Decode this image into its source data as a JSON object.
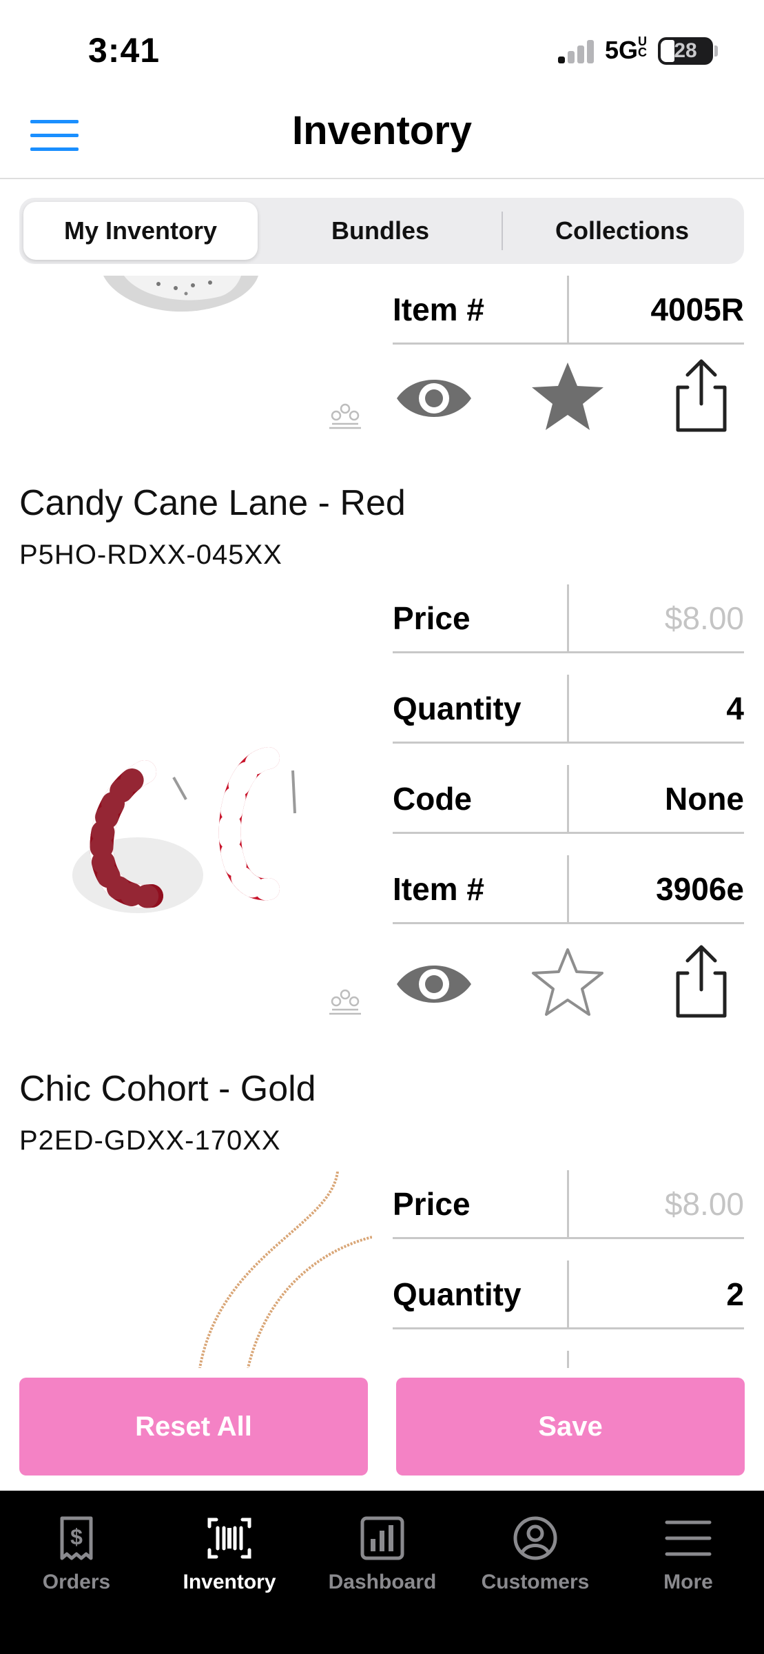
{
  "status_bar": {
    "time": "3:41",
    "network": "5G",
    "network_suffix": "UC",
    "battery": "28",
    "battery_level_fraction": 0.28
  },
  "header": {
    "title": "Inventory",
    "menu_icon": "hamburger-menu-icon",
    "accent_color": "#1a8fff"
  },
  "segments": [
    {
      "label": "My Inventory",
      "active": true
    },
    {
      "label": "Bundles",
      "active": false
    },
    {
      "label": "Collections",
      "active": false
    }
  ],
  "items": [
    {
      "name": "",
      "sku": "",
      "fields": [
        {
          "label": "Item #",
          "value": "4005R"
        }
      ],
      "favorited": true
    },
    {
      "name": "Candy Cane Lane - Red",
      "sku": "P5HO-RDXX-045XX",
      "fields": [
        {
          "label": "Price",
          "value": "$8.00",
          "muted": true
        },
        {
          "label": "Quantity",
          "value": "4"
        },
        {
          "label": "Code",
          "value": "None"
        },
        {
          "label": "Item #",
          "value": "3906e"
        }
      ],
      "favorited": false
    },
    {
      "name": "Chic Cohort - Gold",
      "sku": "P2ED-GDXX-170XX",
      "fields": [
        {
          "label": "Price",
          "value": "$8.00",
          "muted": true
        },
        {
          "label": "Quantity",
          "value": "2"
        }
      ],
      "favorited": false
    }
  ],
  "actions": {
    "reset_label": "Reset All",
    "save_label": "Save",
    "button_color": "#f482c5"
  },
  "tab_bar": {
    "tabs": [
      {
        "label": "Orders",
        "icon": "receipt-dollar-icon",
        "active": false
      },
      {
        "label": "Inventory",
        "icon": "barcode-scan-icon",
        "active": true
      },
      {
        "label": "Dashboard",
        "icon": "bar-chart-icon",
        "active": false
      },
      {
        "label": "Customers",
        "icon": "person-circle-icon",
        "active": false
      },
      {
        "label": "More",
        "icon": "more-lines-icon",
        "active": false
      }
    ]
  }
}
